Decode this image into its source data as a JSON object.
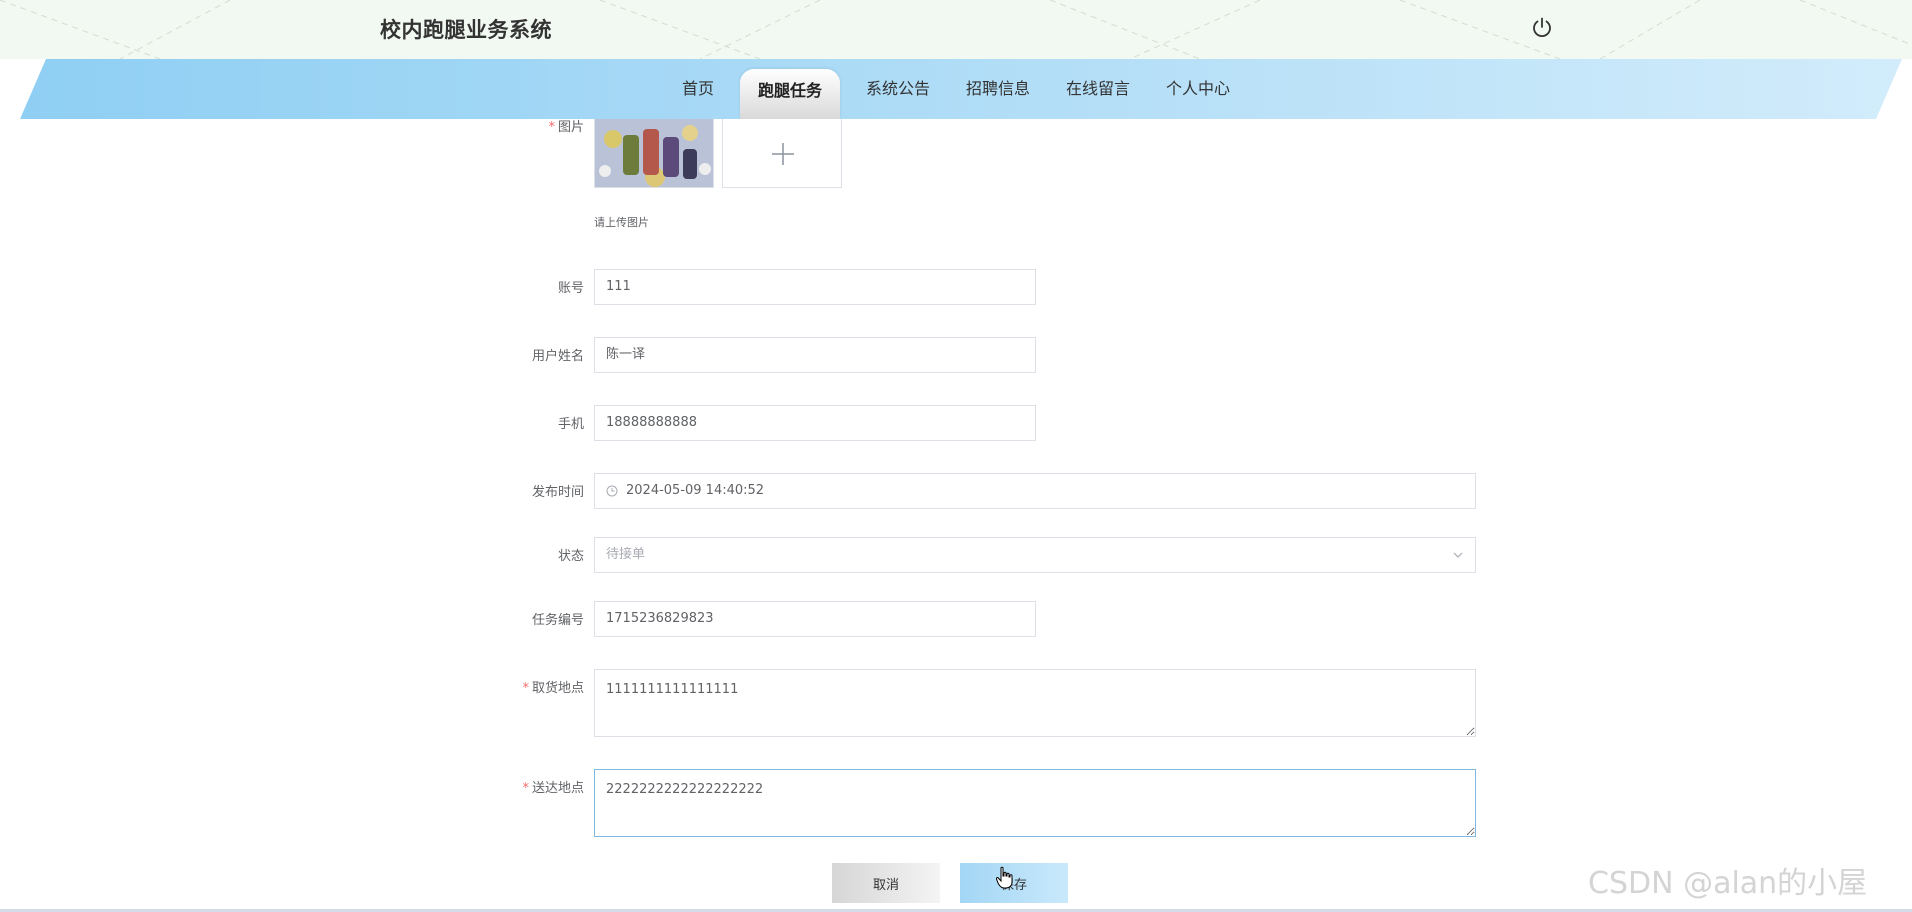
{
  "header": {
    "title": "校内跑腿业务系统",
    "logout_icon": "power-icon"
  },
  "nav": {
    "items": [
      {
        "label": "首页",
        "active": false
      },
      {
        "label": "跑腿任务",
        "active": true
      },
      {
        "label": "系统公告",
        "active": false
      },
      {
        "label": "招聘信息",
        "active": false
      },
      {
        "label": "在线留言",
        "active": false
      },
      {
        "label": "个人中心",
        "active": false
      }
    ]
  },
  "form": {
    "image": {
      "label": "图片",
      "required": true,
      "hint": "请上传图片",
      "add_icon": "plus-icon"
    },
    "account": {
      "label": "账号",
      "value": "111"
    },
    "username": {
      "label": "用户姓名",
      "value": "陈一译"
    },
    "phone": {
      "label": "手机",
      "value": "18888888888"
    },
    "publish_time": {
      "label": "发布时间",
      "value": "2024-05-09 14:40:52",
      "icon": "clock-icon"
    },
    "status": {
      "label": "状态",
      "value": "待接单",
      "icon": "chevron-down-icon"
    },
    "task_no": {
      "label": "任务编号",
      "value": "1715236829823"
    },
    "pickup": {
      "label": "取货地点",
      "required": true,
      "value": "1111111111111111"
    },
    "delivery": {
      "label": "送达地点",
      "required": true,
      "value": "2222222222222222222"
    }
  },
  "actions": {
    "cancel_label": "取消",
    "save_label": "保存"
  },
  "watermark": "CSDN @alan的小屋",
  "colors": {
    "nav_start": "#8fcff3",
    "nav_end": "#d2ecfb",
    "required": "#f56c6c",
    "save_button": "#a3d6f5"
  }
}
